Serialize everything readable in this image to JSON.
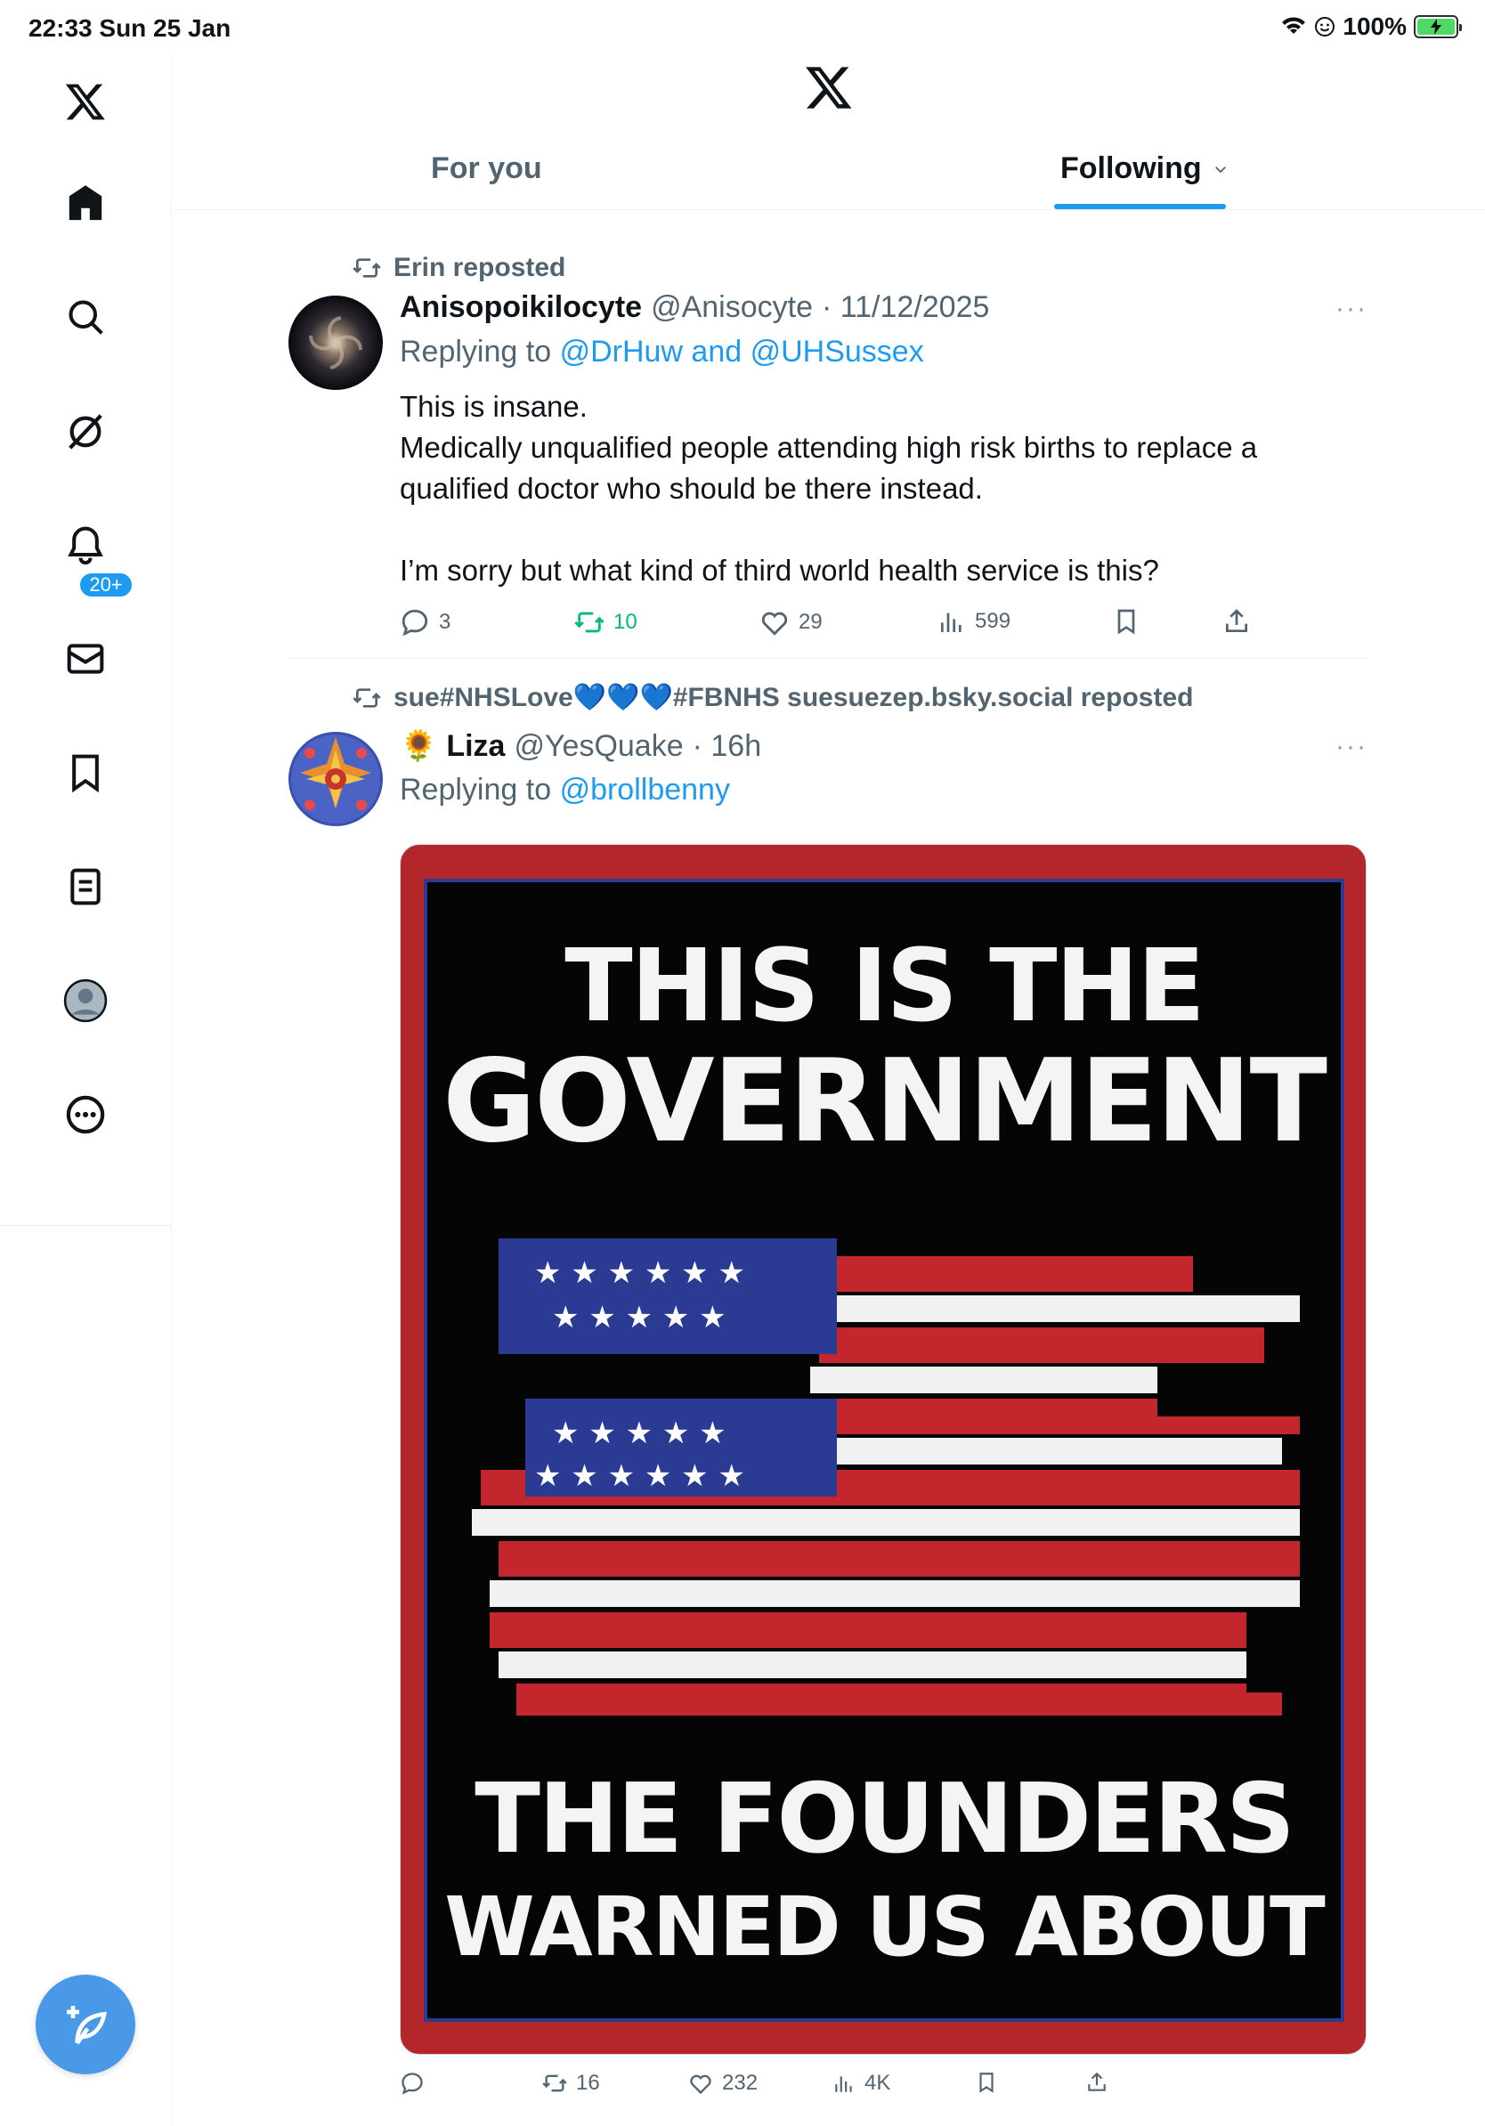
{
  "status_bar": {
    "time_date": "22:33  Sun 25 Jan",
    "battery": "100%"
  },
  "sidebar": {
    "items": [
      "x-logo",
      "home",
      "search",
      "grok",
      "notifications",
      "messages",
      "bookmarks",
      "lists",
      "profile",
      "more"
    ],
    "notification_badge": "20+"
  },
  "tabs": {
    "for_you": "For you",
    "following": "Following"
  },
  "posts": [
    {
      "repost_by": "Erin reposted",
      "author": "Anisopoikilocyte",
      "handle": "@Anisocyte",
      "date": "· 11/12/2025",
      "replying_label": "Replying to",
      "replying_to": "@DrHuw and @UHSussex",
      "text_lines": [
        "This is insane.",
        "Medically unqualified people attending high risk births to replace a qualified doctor who should be there instead.",
        "I’m sorry but what kind of third world health service is this?"
      ],
      "stats": {
        "replies": "3",
        "reposts": "10",
        "likes": "29",
        "views": "599"
      },
      "more": "···"
    },
    {
      "repost_by": "sue#NHSLove💙💙💙#FBNHS suesuezep.bsky.social reposted",
      "author_emoji": "🌻",
      "author": "Liza",
      "handle": "@YesQuake",
      "date": "· 16h",
      "replying_label": "Replying to",
      "replying_to": "@brollbenny",
      "image_text": [
        "THIS IS THE",
        "GOVERNMENT",
        "THE FOUNDERS",
        "WARNED US ABOUT"
      ],
      "stats": {
        "replies": "",
        "reposts": "16",
        "likes": "232",
        "views": "4K"
      },
      "more": "···"
    }
  ],
  "colors": {
    "accent": "#1d9bf0",
    "repost_green": "#00ba7c",
    "secondary_text": "#536471",
    "compose": "#4a99e9"
  }
}
